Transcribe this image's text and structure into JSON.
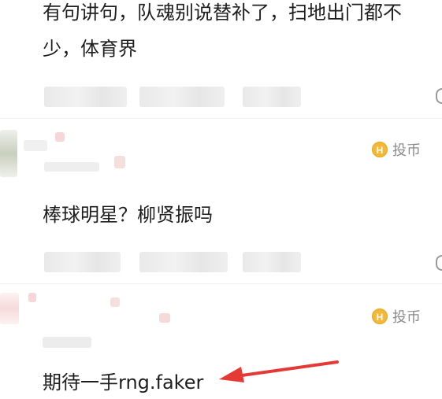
{
  "comments": [
    {
      "text_line1": "有句讲句，队魂别说替补了，扫地出门都不",
      "text_line2": "少，体育界"
    },
    {
      "text": "棒球明星？柳贤振吗",
      "coin_label": "投币"
    },
    {
      "text": "期待一手rng.faker",
      "coin_label": "投币"
    }
  ],
  "icons": {
    "coin": "coin-icon",
    "arrow": "red-arrow-annotation"
  },
  "colors": {
    "coin": "#f5b836",
    "arrow": "#e53935",
    "text": "#1e1e1e",
    "meta": "#8a8a8a"
  }
}
